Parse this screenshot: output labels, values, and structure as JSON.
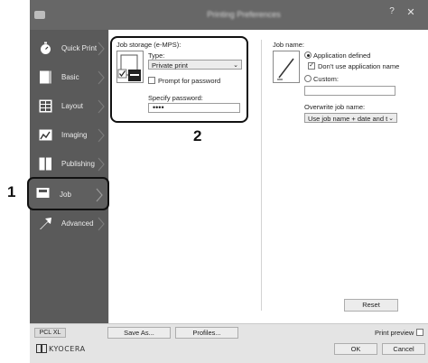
{
  "window": {
    "title": "Printing Preferences",
    "help_label": "?",
    "close_label": "✕"
  },
  "sidebar": {
    "items": [
      {
        "label": "Quick Print",
        "icon": "stopwatch-icon"
      },
      {
        "label": "Basic",
        "icon": "basic-icon"
      },
      {
        "label": "Layout",
        "icon": "layout-icon"
      },
      {
        "label": "Imaging",
        "icon": "imaging-icon"
      },
      {
        "label": "Publishing",
        "icon": "publishing-icon"
      },
      {
        "label": "Job",
        "icon": "job-icon",
        "selected": true
      },
      {
        "label": "Advanced",
        "icon": "advanced-icon"
      }
    ]
  },
  "callouts": {
    "one": "1",
    "two": "2"
  },
  "job_storage": {
    "heading": "Job storage (e-MPS):",
    "type_label": "Type:",
    "type_value": "Private print",
    "prompt_label": "Prompt for password",
    "password_label": "Specify password:",
    "password_value": "••••"
  },
  "job_name": {
    "heading": "Job name:",
    "app_defined_label": "Application defined",
    "dont_use_label": "Don't use application name",
    "custom_label": "Custom:",
    "custom_value": "",
    "overwrite_label": "Overwrite job name:",
    "overwrite_value": "Use job name + date and t"
  },
  "buttons": {
    "reset": "Reset",
    "save_as": "Save As...",
    "profiles": "Profiles...",
    "ok": "OK",
    "cancel": "Cancel"
  },
  "footer": {
    "pdl": "PCL XL",
    "print_preview": "Print preview",
    "brand": "KYOCERA"
  },
  "colors": {
    "sidebar": "#5a5a5a",
    "titlebar": "#676767",
    "accent": "#111111"
  }
}
